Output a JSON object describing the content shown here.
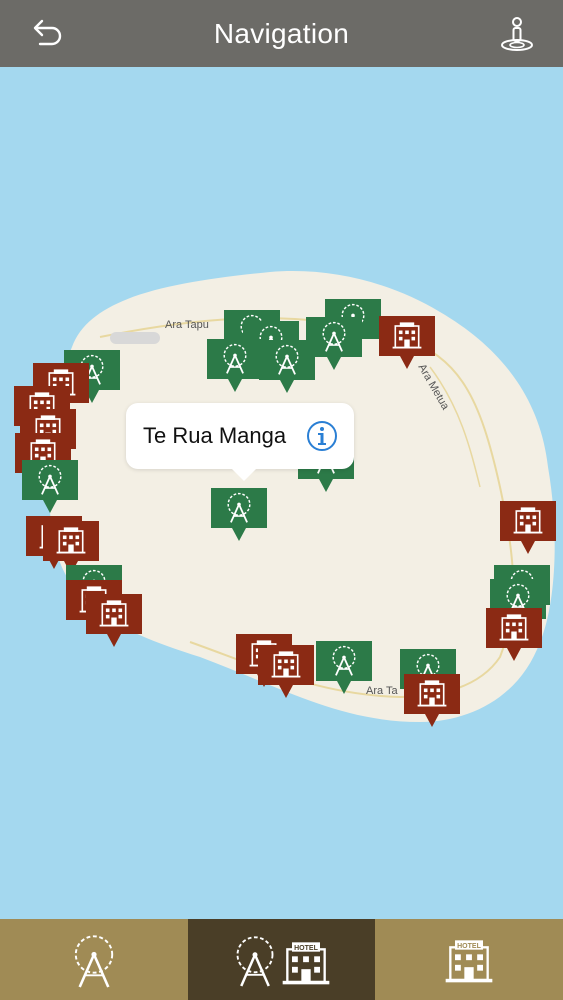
{
  "header": {
    "title": "Navigation",
    "back_icon": "back-arrow-icon",
    "user_icon": "user-location-icon",
    "background": "#6c6b67"
  },
  "map": {
    "water_color": "#a4d8ef",
    "land_color": "#f3efe4",
    "road_labels": [
      "Ara Tapu",
      "Ara Metua",
      "Ara Ta"
    ],
    "attraction_color": "#2c7a48",
    "hotel_color": "#8b2a14",
    "selected_place": {
      "name": "Te Rua Manga",
      "info_icon": "info-icon"
    }
  },
  "tabbar": {
    "tabs": [
      {
        "name": "attractions",
        "icon": "ferris-wheel-icon",
        "selected": false
      },
      {
        "name": "all",
        "icon": "ferris-wheel-and-hotel-icon",
        "selected": true
      },
      {
        "name": "hotels",
        "icon": "hotel-icon",
        "selected": false
      }
    ],
    "hotel_sign": "HOTEL",
    "active_color": "#4a3e27",
    "inactive_color": "#a08b55"
  }
}
